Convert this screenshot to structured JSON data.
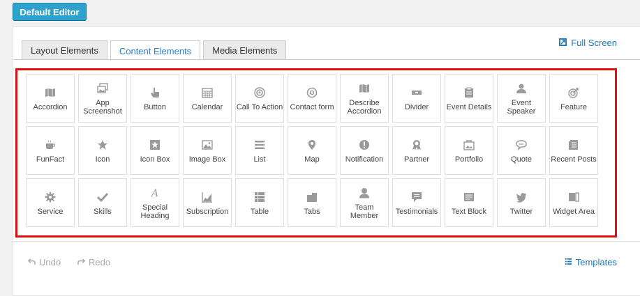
{
  "header": {
    "default_editor_label": "Default Editor"
  },
  "tabs": [
    {
      "label": "Layout Elements",
      "active": false
    },
    {
      "label": "Content Elements",
      "active": true
    },
    {
      "label": "Media Elements",
      "active": false
    }
  ],
  "fullscreen_label": "Full Screen",
  "elements": [
    {
      "label": "Accordion",
      "icon": "map-icon"
    },
    {
      "label": "App Screenshot",
      "icon": "images-icon"
    },
    {
      "label": "Button",
      "icon": "pointer-hand-icon"
    },
    {
      "label": "Calendar",
      "icon": "calendar-icon"
    },
    {
      "label": "Call To Action",
      "icon": "target-icon"
    },
    {
      "label": "Contact form",
      "icon": "at-icon"
    },
    {
      "label": "Describe Accordion",
      "icon": "map-icon"
    },
    {
      "label": "Divider",
      "icon": "divider-icon"
    },
    {
      "label": "Event Details",
      "icon": "clipboard-icon"
    },
    {
      "label": "Event Speaker",
      "icon": "user-icon"
    },
    {
      "label": "Feature",
      "icon": "bullseye-icon"
    },
    {
      "label": "FunFact",
      "icon": "coffee-icon"
    },
    {
      "label": "Icon",
      "icon": "star-icon"
    },
    {
      "label": "Icon Box",
      "icon": "star-box-icon"
    },
    {
      "label": "Image Box",
      "icon": "picture-icon"
    },
    {
      "label": "List",
      "icon": "list-icon"
    },
    {
      "label": "Map",
      "icon": "map-pin-icon"
    },
    {
      "label": "Notification",
      "icon": "alert-icon"
    },
    {
      "label": "Partner",
      "icon": "award-icon"
    },
    {
      "label": "Portfolio",
      "icon": "portfolio-icon"
    },
    {
      "label": "Quote",
      "icon": "chat-bubble-icon"
    },
    {
      "label": "Recent Posts",
      "icon": "posts-icon"
    },
    {
      "label": "Service",
      "icon": "gear-icon"
    },
    {
      "label": "Skills",
      "icon": "check-icon"
    },
    {
      "label": "Special Heading",
      "icon": "script-a-icon"
    },
    {
      "label": "Subscription",
      "icon": "chart-icon"
    },
    {
      "label": "Table",
      "icon": "table-icon"
    },
    {
      "label": "Tabs",
      "icon": "tabs-icon"
    },
    {
      "label": "Team Member",
      "icon": "person-icon"
    },
    {
      "label": "Testimonials",
      "icon": "comment-icon"
    },
    {
      "label": "Text Block",
      "icon": "text-block-icon"
    },
    {
      "label": "Twitter",
      "icon": "twitter-icon"
    },
    {
      "label": "Widget Area",
      "icon": "widget-icon"
    }
  ],
  "footer": {
    "undo_label": "Undo",
    "redo_label": "Redo",
    "templates_label": "Templates"
  },
  "colors": {
    "accent": "#2ea2cc",
    "link": "#2177b8",
    "highlight_border": "#dd1111",
    "icon": "#9a9a9a"
  }
}
